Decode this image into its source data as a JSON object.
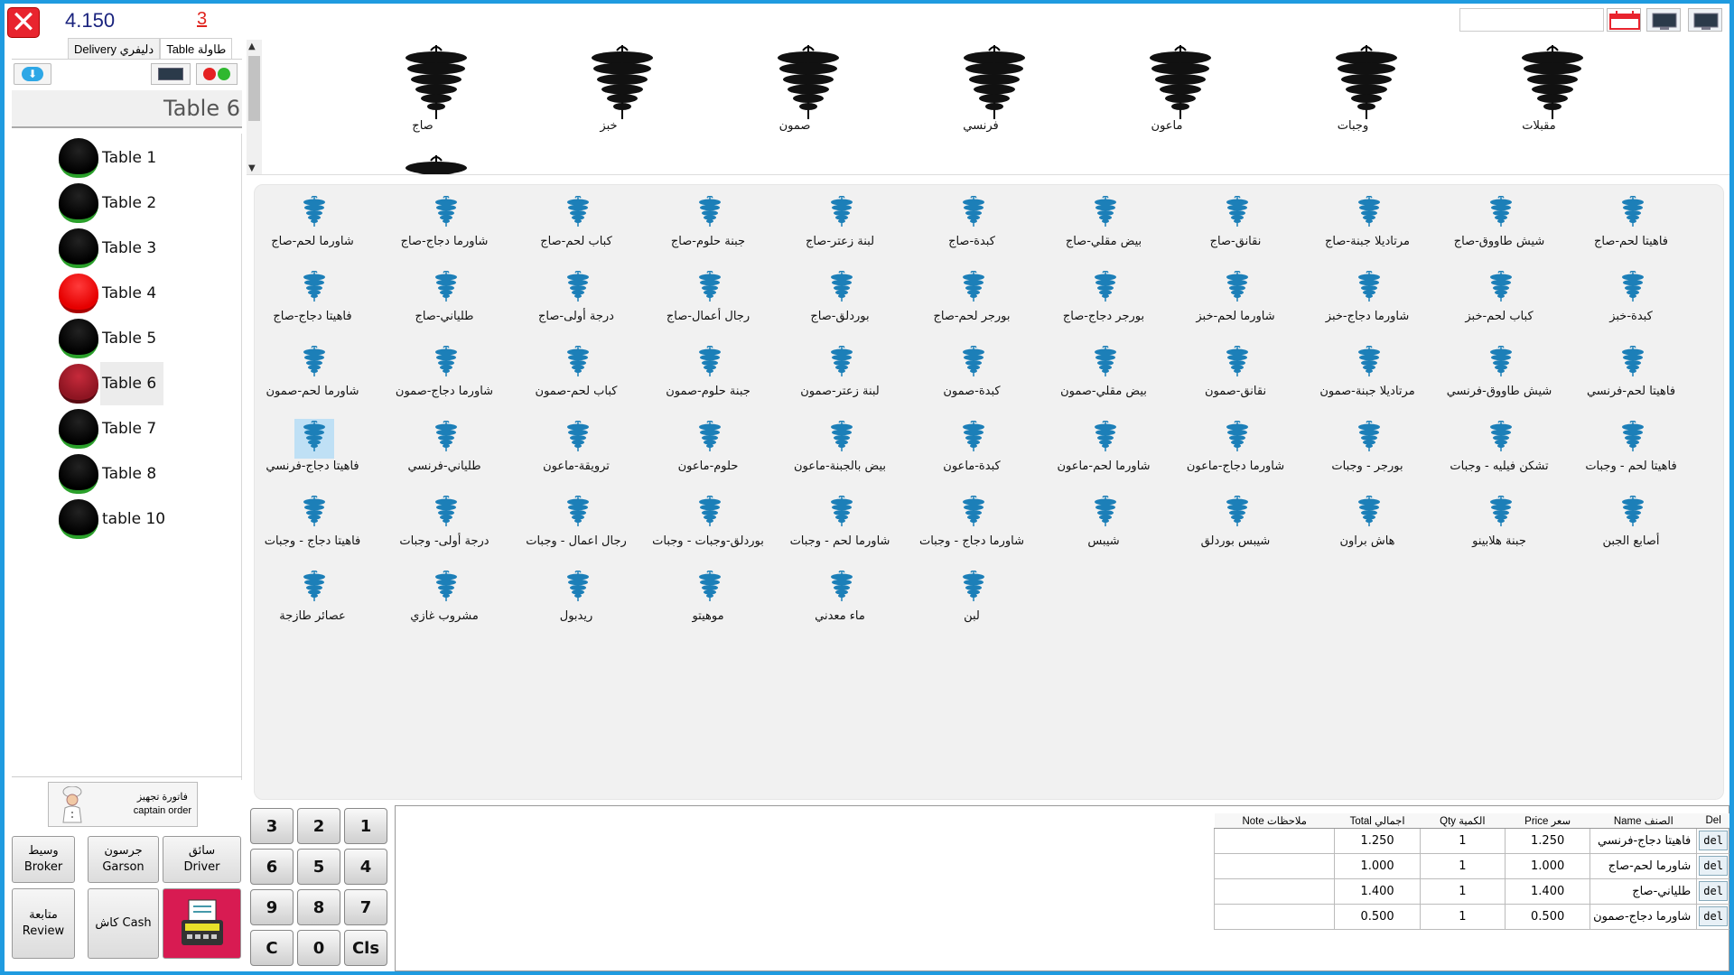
{
  "header": {
    "total": "4.150",
    "count": "3",
    "close_icon": "close-icon"
  },
  "tabs": [
    {
      "label": "Delivery دليفري"
    },
    {
      "label": "Table طاولة"
    }
  ],
  "current_table": "Table 6",
  "tables": [
    {
      "label": "Table 1",
      "status": "black"
    },
    {
      "label": "Table 2",
      "status": "black"
    },
    {
      "label": "Table 3",
      "status": "black"
    },
    {
      "label": "Table 4",
      "status": "red"
    },
    {
      "label": "Table 5",
      "status": "black"
    },
    {
      "label": "Table 6",
      "status": "darkred"
    },
    {
      "label": "Table 7",
      "status": "black"
    },
    {
      "label": "Table 8",
      "status": "black"
    },
    {
      "label": "table 10",
      "status": "black"
    }
  ],
  "captain_order": {
    "line1": "فاتورة تجهيز",
    "line2": "captain order"
  },
  "left_buttons": {
    "broker": {
      "line1": "وسيط",
      "line2": "Broker"
    },
    "garson": {
      "line1": "جرسون",
      "line2": "Garson"
    },
    "driver": {
      "line1": "سائق",
      "line2": "Driver"
    },
    "review": {
      "line1": "متابعة",
      "line2": "Review"
    },
    "cash": {
      "label": "كاش Cash"
    }
  },
  "numpad": {
    "k1": "1",
    "k2": "2",
    "k3": "3",
    "k4": "4",
    "k5": "5",
    "k6": "6",
    "k7": "7",
    "k8": "8",
    "k9": "9",
    "k0": "0",
    "kc": "C",
    "kcls": "Cls"
  },
  "categories": [
    "مقبلات",
    "وجبات",
    "ماعون",
    "فرنسي",
    "صمون",
    "خبز",
    "صاج"
  ],
  "items": [
    [
      "فاهيتا لحم-صاج",
      "شيش طاووق-صاج",
      "مرتاديلا جبنة-صاج",
      "نقانق-صاج",
      "بيض مقلي-صاج",
      "كبدة-صاج",
      "لبنة زعتر-صاج",
      "جبنة حلوم-صاج",
      "كباب لحم-صاج",
      "شاورما دجاج-صاج",
      "شاورما لحم-صاج"
    ],
    [
      "كبدة-خبز",
      "كباب لحم-خبز",
      "شاورما دجاج-خبز",
      "شاورما لحم-خبز",
      "بورجر دجاج-صاج",
      "بورجر لحم-صاج",
      "بوردلق-صاج",
      "رجال أعمال-صاج",
      "درجة أولى-صاج",
      "طلياني-صاج",
      "فاهيتا دجاج-صاج"
    ],
    [
      "فاهيتا لحم-فرنسي",
      "شيش طاووق-فرنسي",
      "مرتاديلا جبنة-صمون",
      "نقانق-صمون",
      "بيض مقلي-صمون",
      "كبدة-صمون",
      "لبنة زعتر-صمون",
      "جبنة حلوم-صمون",
      "كباب لحم-صمون",
      "شاورما دجاج-صمون",
      "شاورما لحم-صمون"
    ],
    [
      "فاهيتا لحم - وجبات",
      "تشكن فيليه - وجبات",
      "بورجر - وجبات",
      "شاورما دجاج-ماعون",
      "شاورما لحم-ماعون",
      "كبدة-ماعون",
      "بيض بالجبنة-ماعون",
      "حلوم-ماعون",
      "ترويقة-ماعون",
      "طلياني-فرنسي",
      "فاهيتا دجاج-فرنسي"
    ],
    [
      "أصابع الجبن",
      "جبنة هلابينو",
      "هاش براون",
      "شيبس بوردلق",
      "شيبس",
      "شاورما دجاج - وجبات",
      "شاورما لحم - وجبات",
      "بوردلق-وجبات - وجبات",
      "رجال اعمال - وجبات",
      "درجة أولى- وجبات",
      "فاهيتا دجاج - وجبات"
    ],
    [
      "",
      "",
      "",
      "",
      "",
      "لبن",
      "ماء معدني",
      "موهيتو",
      "ريدبول",
      "مشروب غازي",
      "عصائر طازجة"
    ]
  ],
  "order": {
    "headers": {
      "del": "Del",
      "name": "Name الصنف",
      "price": "Price سعر",
      "qty": "Qty الكمية",
      "total": "Total اجمالي",
      "note": "Note ملاحظات"
    },
    "del_label": "del",
    "rows": [
      {
        "name": "فاهيتا دجاج-فرنسي",
        "price": "1.250",
        "qty": "1",
        "total": "1.250",
        "note": ""
      },
      {
        "name": "شاورما لحم-صاج",
        "price": "1.000",
        "qty": "1",
        "total": "1.000",
        "note": ""
      },
      {
        "name": "طلياني-صاج",
        "price": "1.400",
        "qty": "1",
        "total": "1.400",
        "note": ""
      },
      {
        "name": "شاورما دجاج-صمون",
        "price": "0.500",
        "qty": "1",
        "total": "0.500",
        "note": ""
      }
    ]
  },
  "colors": {
    "accent": "#1f9be0",
    "danger": "#e8242e",
    "print": "#d81b52",
    "item_icon": "#1c7fb8"
  }
}
